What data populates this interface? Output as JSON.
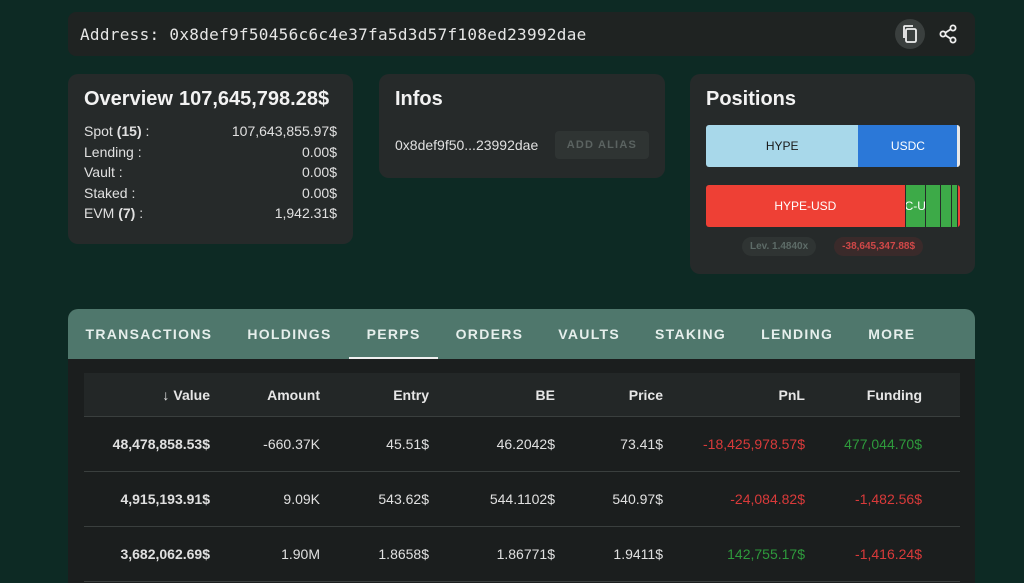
{
  "address_bar": {
    "label": "Address:",
    "address": "0x8def9f50456c6c4e37fa5d3d57f108ed23992dae",
    "copy_icon": "copy-icon",
    "share_icon": "share-icon"
  },
  "overview": {
    "title": "Overview",
    "total": "107,645,798.28$",
    "rows": [
      {
        "label": "Spot",
        "count": "(15)",
        "suffix": " :",
        "value": "107,643,855.97$"
      },
      {
        "label": "Lending",
        "count": "",
        "suffix": " :",
        "value": "0.00$"
      },
      {
        "label": "Vault",
        "count": "",
        "suffix": " :",
        "value": "0.00$"
      },
      {
        "label": "Staked",
        "count": "",
        "suffix": " :",
        "value": "0.00$"
      },
      {
        "label": "EVM",
        "count": "(7)",
        "suffix": " :",
        "value": "1,942.31$"
      }
    ]
  },
  "infos": {
    "title": "Infos",
    "short_address": "0x8def9f50...23992dae",
    "alias_button": "ADD ALIAS"
  },
  "positions": {
    "title": "Positions",
    "spot_segments": [
      {
        "label": "HYPE",
        "fraction": 0.6,
        "color": "#a8d8ea"
      },
      {
        "label": "USDC",
        "fraction": 0.39,
        "color": "#2b78d8"
      },
      {
        "label": "",
        "fraction": 0.01,
        "color": "#e8e8e8"
      }
    ],
    "perp_segments": [
      {
        "label": "HYPE-USD",
        "fraction": 0.79,
        "color": "#ee4035"
      },
      {
        "label": "C-U",
        "fraction": 0.08,
        "color": "#3daa48"
      },
      {
        "label": "",
        "fraction": 0.06,
        "color": "#3daa48"
      },
      {
        "label": "",
        "fraction": 0.045,
        "color": "#3daa48"
      },
      {
        "label": "",
        "fraction": 0.025,
        "color": "#3daa48"
      },
      {
        "label": "",
        "fraction": 0.01,
        "color": "#ee4035"
      }
    ],
    "leverage": "Lev. 1.4840x",
    "pnl": "-38,645,347.88$"
  },
  "tabs": [
    {
      "label": "TRANSACTIONS",
      "active": false
    },
    {
      "label": "HOLDINGS",
      "active": false
    },
    {
      "label": "PERPS",
      "active": true
    },
    {
      "label": "ORDERS",
      "active": false
    },
    {
      "label": "VAULTS",
      "active": false
    },
    {
      "label": "STAKING",
      "active": false
    },
    {
      "label": "LENDING",
      "active": false
    },
    {
      "label": "MORE",
      "active": false
    }
  ],
  "table": {
    "sort_arrow": "↓",
    "headers": [
      "Value",
      "Amount",
      "Entry",
      "BE",
      "Price",
      "PnL",
      "Funding"
    ],
    "rows": [
      {
        "value": "48,478,858.53$",
        "amount": "-660.37K",
        "entry": "45.51$",
        "be": "46.2042$",
        "price": "73.41$",
        "pnl": "-18,425,978.57$",
        "pnl_sign": "neg",
        "funding": "477,044.70$",
        "funding_sign": "pos"
      },
      {
        "value": "4,915,193.91$",
        "amount": "9.09K",
        "entry": "543.62$",
        "be": "544.1102$",
        "price": "540.97$",
        "pnl": "-24,084.82$",
        "pnl_sign": "neg",
        "funding": "-1,482.56$",
        "funding_sign": "neg"
      },
      {
        "value": "3,682,062.69$",
        "amount": "1.90M",
        "entry": "1.8658$",
        "be": "1.86771$",
        "price": "1.9411$",
        "pnl": "142,755.17$",
        "pnl_sign": "pos",
        "funding": "-1,416.24$",
        "funding_sign": "neg"
      }
    ]
  }
}
